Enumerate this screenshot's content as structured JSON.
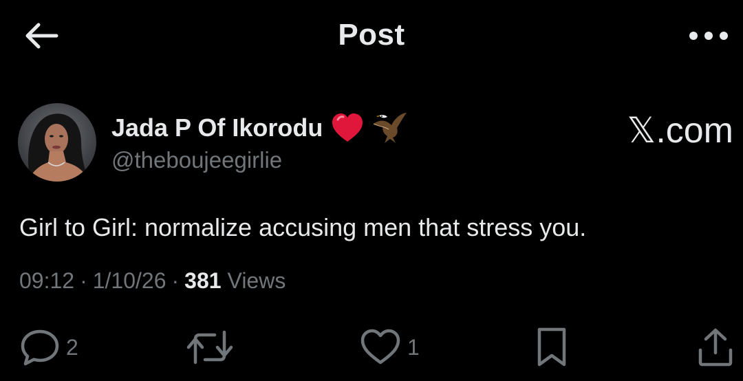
{
  "header": {
    "title": "Post",
    "back_icon": "arrow-left-icon",
    "more_icon": "more-horizontal-icon"
  },
  "author": {
    "display_name": "Jada P Of Ikorodu",
    "handle": "@theboujeegirlie",
    "badges": [
      "red-heart-emoji",
      "eagle-emoji"
    ]
  },
  "watermark": "𝕏.com",
  "post": {
    "text": "Girl to Girl: normalize accusing men that stress you.",
    "time": "09:12",
    "date": "1/10/26",
    "separator": "·",
    "views_count": "381",
    "views_label": "Views"
  },
  "actions": {
    "replies": "2",
    "likes": "1"
  },
  "colors": {
    "background": "#000000",
    "text": "#e7e9ea",
    "muted": "#71767b",
    "heart": "#e0163a"
  }
}
